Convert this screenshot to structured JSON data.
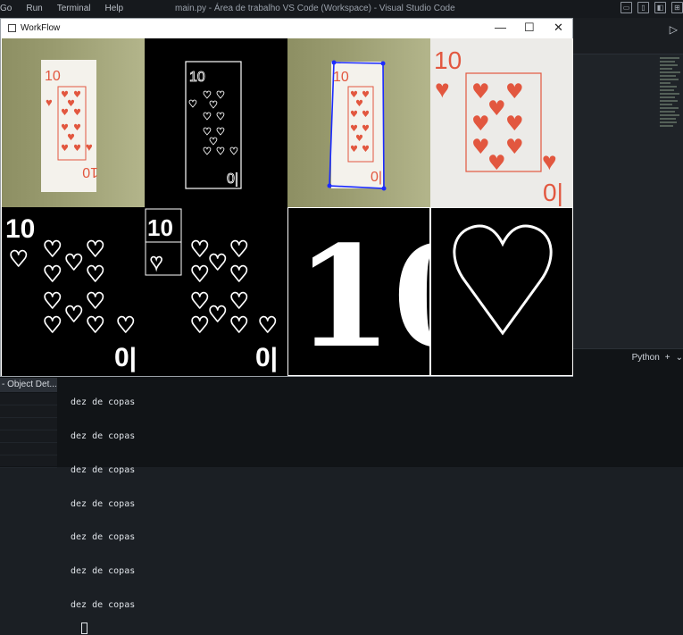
{
  "app": {
    "menu": [
      "Go",
      "Run",
      "Terminal",
      "Help"
    ],
    "title": "main.py - Área de trabalho VS Code (Workspace) - Visual Studio Code"
  },
  "cv_window": {
    "title": "WorkFlow",
    "minimize": "—",
    "maximize": "☐",
    "close": "✕",
    "labels": {
      "ten_big": "10",
      "ten_small": "10",
      "ten_card": "10",
      "ten_white": "10"
    }
  },
  "panel": {
    "language": "Python",
    "add": "+",
    "dropdown": "⌄",
    "sidebar_item": "- Object Det...",
    "terminal_lines": [
      "dez de copas",
      "dez de copas",
      "dez de copas",
      "dez de copas",
      "dez de copas",
      "dez de copas",
      "dez de copas"
    ]
  },
  "colors": {
    "card_red": "#e2573f",
    "detector_blue": "#1b2bff"
  }
}
